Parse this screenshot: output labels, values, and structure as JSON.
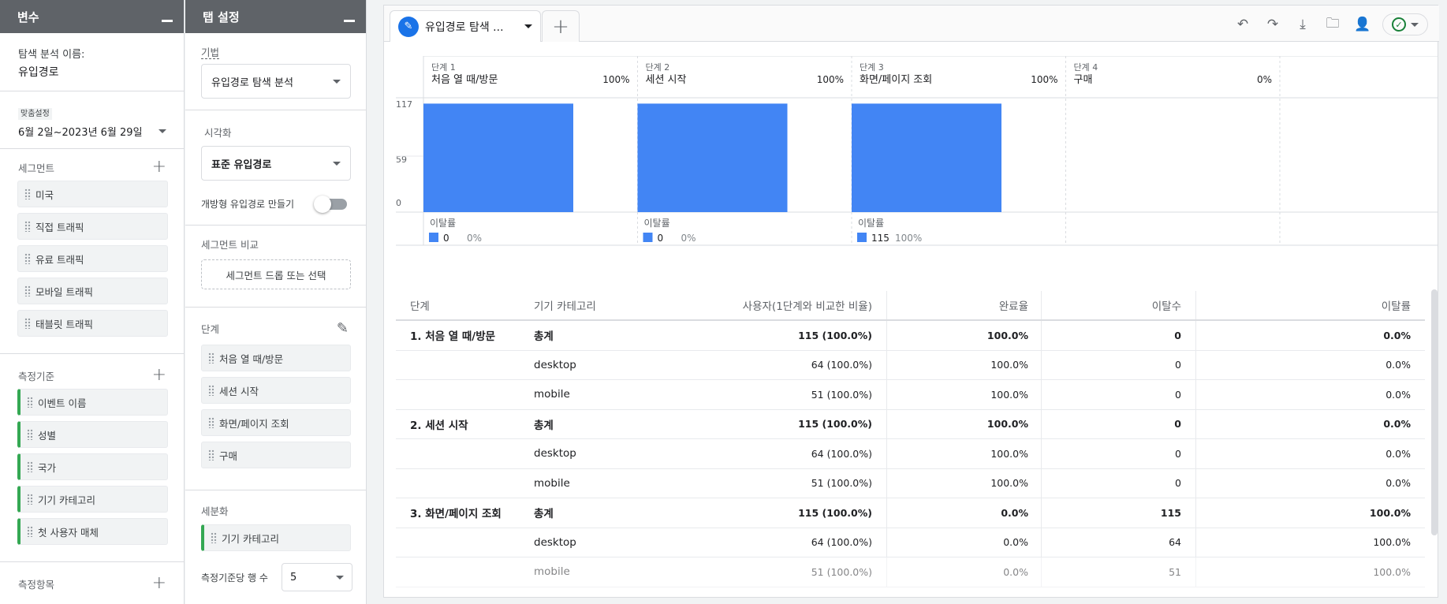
{
  "variables": {
    "title": "변수",
    "exploration_name_label": "탐색 분석 이름:",
    "exploration_name": "유입경로",
    "date_tag": "맞춤설정",
    "date_range": "6월 2일~2023년 6월 29일",
    "segments_label": "세그먼트",
    "segments": [
      "미국",
      "직접 트래픽",
      "유료 트래픽",
      "모바일 트래픽",
      "태블릿 트래픽"
    ],
    "dimensions_label": "측정기준",
    "dimensions": [
      "이벤트 이름",
      "성별",
      "국가",
      "기기 카테고리",
      "첫 사용자 매체"
    ],
    "metrics_label": "측정항목"
  },
  "tab_settings": {
    "title": "탭 설정",
    "technique_label": "기법",
    "technique_value": "유입경로 탐색 분석",
    "visualization_label": "시각화",
    "visualization_value": "표준 유입경로",
    "open_funnel_label": "개방형 유입경로 만들기",
    "segment_compare_label": "세그먼트 비교",
    "segment_drop_label": "세그먼트 드롭 또는 선택",
    "steps_label": "단계",
    "steps": [
      "처음 열 때/방문",
      "세션 시작",
      "화면/페이지 조회",
      "구매"
    ],
    "breakdown_label": "세분화",
    "breakdown_value": "기기 카테고리",
    "rows_per_dim_label": "측정기준당 행 수",
    "rows_per_dim_value": "5"
  },
  "tabbar": {
    "active_tab": "유입경로 탐색 ...",
    "icons": [
      "undo-icon",
      "redo-icon",
      "download-icon",
      "move-folder-icon",
      "share-user-icon",
      "check-circle-icon"
    ]
  },
  "colors": {
    "bar": "#4285f4",
    "accent": "#1a73e8",
    "dimension_chip": "#34a853"
  },
  "chart_data": {
    "type": "bar",
    "categories": [
      "처음 열 때/방문",
      "세션 시작",
      "화면/페이지 조회",
      "구매"
    ],
    "step_labels": [
      "단계 1",
      "단계 2",
      "단계 3",
      "단계 4"
    ],
    "step_pct": [
      "100%",
      "100%",
      "100%",
      "0%"
    ],
    "values": [
      115,
      115,
      115,
      0
    ],
    "y_ticks": [
      "117",
      "59",
      "0"
    ],
    "ylim": [
      0,
      117
    ],
    "dropoff_label": "이탈률",
    "dropoff": [
      {
        "count": "0",
        "rate": "0%"
      },
      {
        "count": "0",
        "rate": "0%"
      },
      {
        "count": "115",
        "rate": "100%"
      }
    ]
  },
  "table": {
    "headers": [
      "단계",
      "기기 카테고리",
      "사용자(1단계와 비교한 비율)",
      "완료율",
      "이탈수",
      "이탈률"
    ],
    "rows": [
      {
        "step": "1. 처음 열 때/방문",
        "cat": "총계",
        "users": "115 (100.0%)",
        "comp": "100.0%",
        "drop": "0",
        "rate": "0.0%",
        "total": true
      },
      {
        "step": "",
        "cat": "desktop",
        "users": "64 (100.0%)",
        "comp": "100.0%",
        "drop": "0",
        "rate": "0.0%"
      },
      {
        "step": "",
        "cat": "mobile",
        "users": "51 (100.0%)",
        "comp": "100.0%",
        "drop": "0",
        "rate": "0.0%"
      },
      {
        "step": "2. 세션 시작",
        "cat": "총계",
        "users": "115 (100.0%)",
        "comp": "100.0%",
        "drop": "0",
        "rate": "0.0%",
        "total": true
      },
      {
        "step": "",
        "cat": "desktop",
        "users": "64 (100.0%)",
        "comp": "100.0%",
        "drop": "0",
        "rate": "0.0%"
      },
      {
        "step": "",
        "cat": "mobile",
        "users": "51 (100.0%)",
        "comp": "100.0%",
        "drop": "0",
        "rate": "0.0%"
      },
      {
        "step": "3. 화면/페이지 조회",
        "cat": "총계",
        "users": "115 (100.0%)",
        "comp": "0.0%",
        "drop": "115",
        "rate": "100.0%",
        "total": true
      },
      {
        "step": "",
        "cat": "desktop",
        "users": "64 (100.0%)",
        "comp": "0.0%",
        "drop": "64",
        "rate": "100.0%"
      },
      {
        "step": "",
        "cat": "mobile",
        "users": "51 (100.0%)",
        "comp": "0.0%",
        "drop": "51",
        "rate": "100.0%"
      }
    ]
  }
}
